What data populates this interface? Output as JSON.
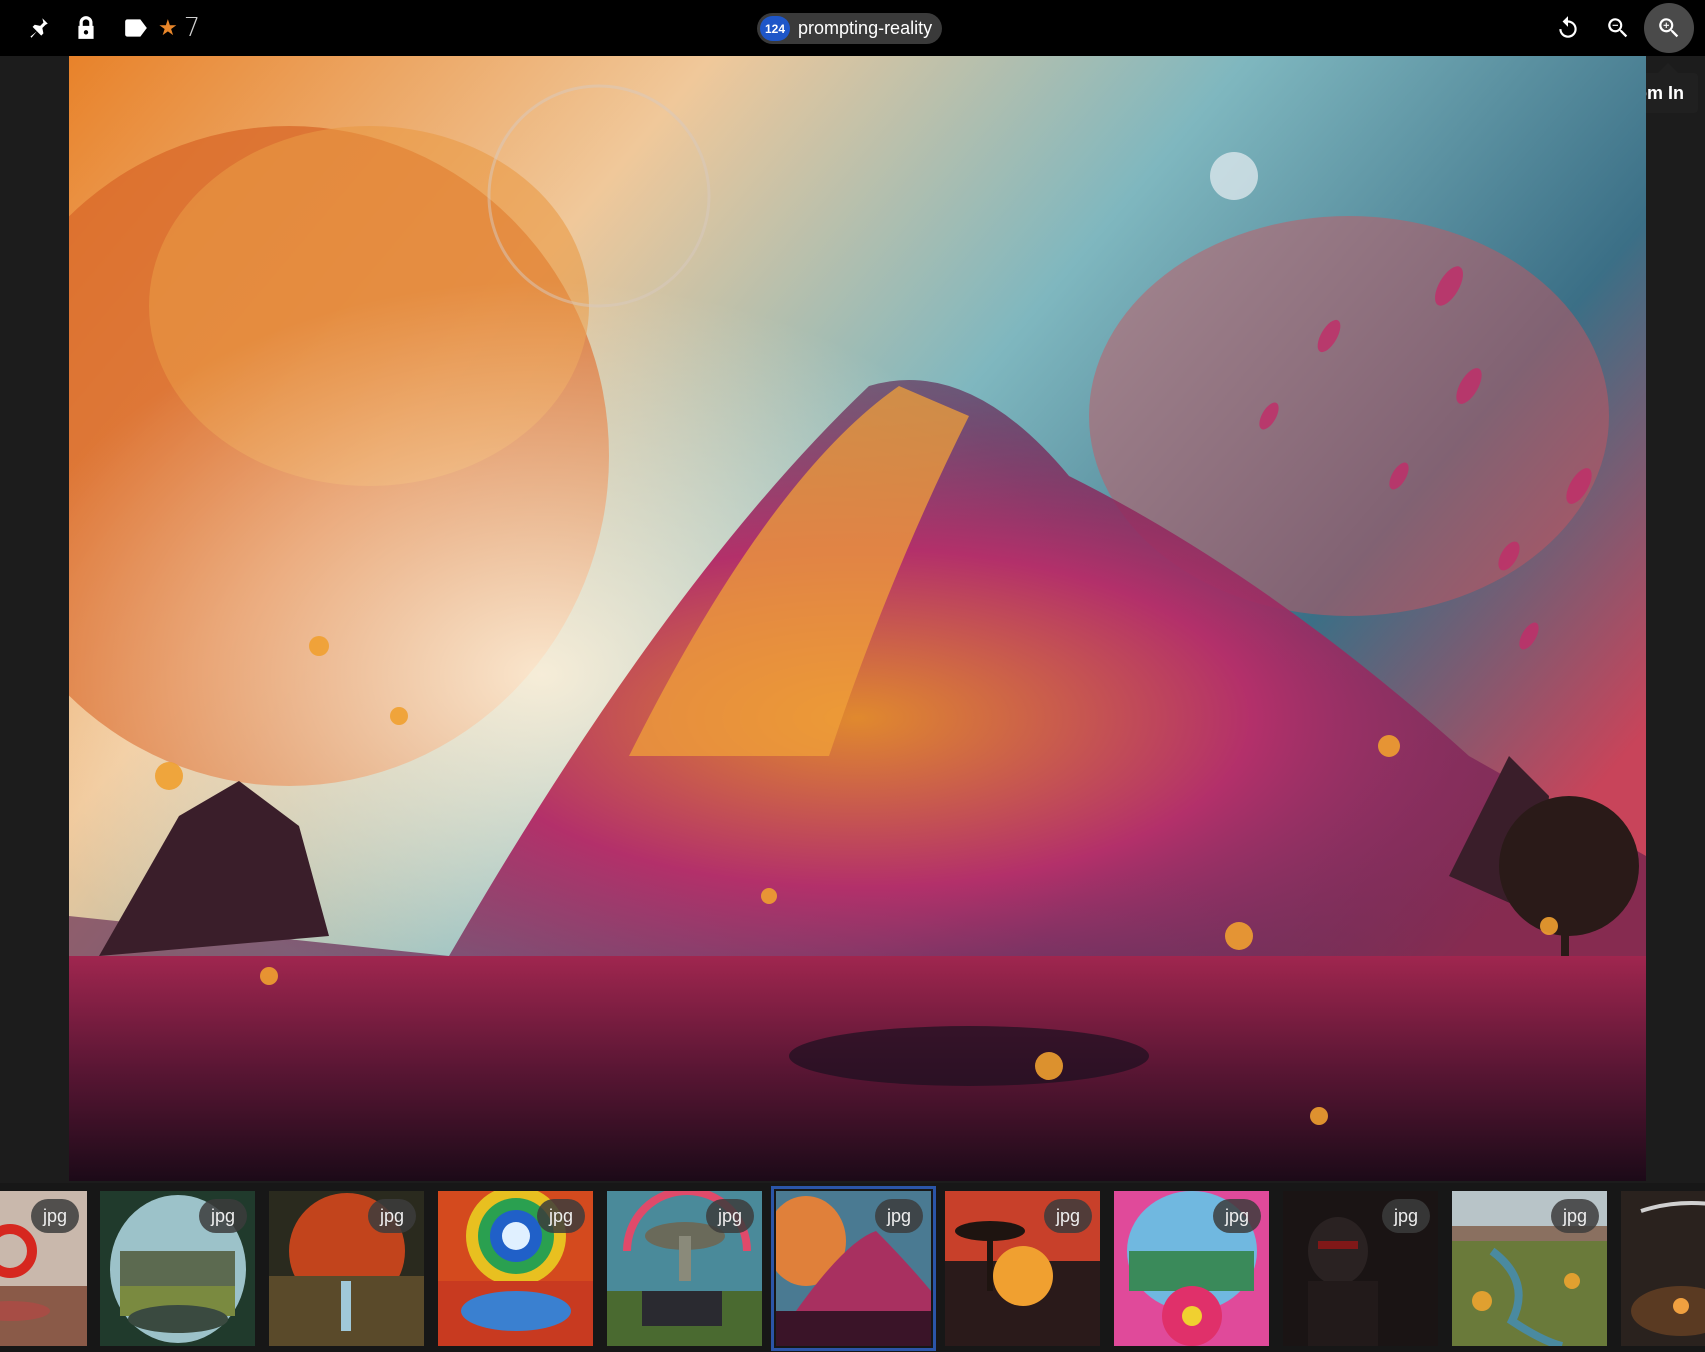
{
  "toolbar": {
    "left_icons": [
      "pin-icon",
      "lock-icon",
      "tag-icon"
    ],
    "rating_icon": "star-icon",
    "rating_value": "7",
    "collection": {
      "count": "124",
      "name": "prompting-reality"
    },
    "right_icons": [
      "rotate-icon",
      "zoom-out-icon",
      "zoom-in-icon"
    ],
    "tooltip": "Zoom In"
  },
  "viewer": {
    "scroll_icon": "arrow-down-icon"
  },
  "filmstrip": {
    "thumbnails": [
      {
        "ext": "jpg",
        "selected": false
      },
      {
        "ext": "jpg",
        "selected": false
      },
      {
        "ext": "jpg",
        "selected": false
      },
      {
        "ext": "jpg",
        "selected": false
      },
      {
        "ext": "jpg",
        "selected": false
      },
      {
        "ext": "jpg",
        "selected": true
      },
      {
        "ext": "jpg",
        "selected": false
      },
      {
        "ext": "jpg",
        "selected": false
      },
      {
        "ext": "jpg",
        "selected": false
      },
      {
        "ext": "jpg",
        "selected": false
      },
      {
        "ext": "",
        "selected": false
      }
    ]
  },
  "colors": {
    "accent": "#2b55a8",
    "badge": "#1e56c8",
    "star": "#e8862a",
    "topbar": "#000000",
    "background": "#1c1c1c"
  }
}
